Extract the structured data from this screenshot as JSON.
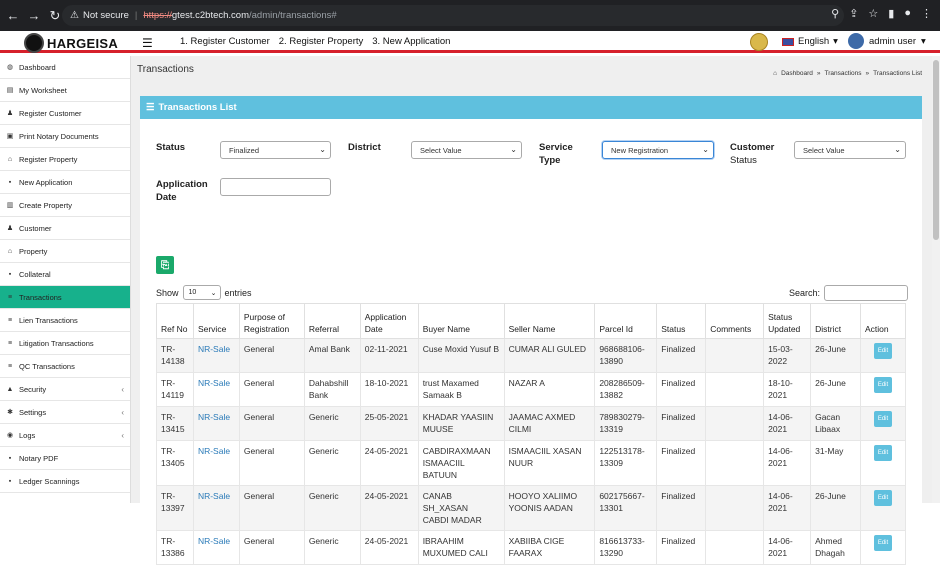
{
  "browser": {
    "not_secure": "Not secure",
    "url_scheme": "https://",
    "url_host": "gtest.c2btech.com",
    "url_path": "/admin/transactions#"
  },
  "header": {
    "logo_text": "HARGEISA",
    "nav": [
      "1. Register Customer",
      "2. Register Property",
      "3. New Application"
    ],
    "language": "English",
    "user": "admin user"
  },
  "sidebar": {
    "items": [
      {
        "label": "Dashboard",
        "icon": "dashboard-icon"
      },
      {
        "label": "My Worksheet",
        "icon": "worksheet-icon"
      },
      {
        "label": "Register Customer",
        "icon": "user-icon"
      },
      {
        "label": "Print Notary Documents",
        "icon": "print-icon"
      },
      {
        "label": "Register Property",
        "icon": "home-icon"
      },
      {
        "label": "New Application",
        "icon": "file-icon"
      },
      {
        "label": "Create Property",
        "icon": "building-icon"
      },
      {
        "label": "Customer",
        "icon": "user-icon"
      },
      {
        "label": "Property",
        "icon": "home-icon"
      },
      {
        "label": "Collateral",
        "icon": "file-icon"
      },
      {
        "label": "Transactions",
        "icon": "list-icon"
      },
      {
        "label": "Lien Transactions",
        "icon": "list-icon"
      },
      {
        "label": "Litigation Transactions",
        "icon": "list-icon"
      },
      {
        "label": "QC Transactions",
        "icon": "list-icon"
      },
      {
        "label": "Security",
        "icon": "lock-icon"
      },
      {
        "label": "Settings",
        "icon": "gear-icon"
      },
      {
        "label": "Logs",
        "icon": "eye-icon"
      },
      {
        "label": "Notary PDF",
        "icon": "file-icon"
      },
      {
        "label": "Ledger Scannings",
        "icon": "file-icon"
      }
    ]
  },
  "page": {
    "title": "Transactions",
    "breadcrumb": [
      "Dashboard",
      "Transactions",
      "Transactions List"
    ],
    "panel_title": "Transactions List"
  },
  "filters": {
    "status_label": "Status",
    "status_value": "Finalized",
    "district_label": "District",
    "district_value": "Select Value",
    "service_type_label_1": "Service",
    "service_type_label_2": "Type",
    "service_type_value": "New Registration",
    "customer_status_label_1": "Customer",
    "customer_status_label_2": "Status",
    "customer_status_value": "Select Value",
    "app_date_label_1": "Application",
    "app_date_label_2": "Date"
  },
  "table_controls": {
    "show_label": "Show",
    "show_value": "10",
    "entries_label": "entries",
    "search_label": "Search:"
  },
  "table": {
    "headers": [
      [
        "Ref No"
      ],
      [
        "Service"
      ],
      [
        "Purpose of",
        "Registration"
      ],
      [
        "Referral"
      ],
      [
        "Application",
        "Date"
      ],
      [
        "Buyer Name"
      ],
      [
        "Seller Name"
      ],
      [
        "Parcel Id"
      ],
      [
        "Status"
      ],
      [
        "Comments"
      ],
      [
        "Status",
        "Updated"
      ],
      [
        "District"
      ],
      [
        "Action"
      ]
    ],
    "rows": [
      {
        "ref": [
          "TR-",
          "14138"
        ],
        "service": "NR-Sale",
        "purpose": "General",
        "referral": [
          "Amal Bank"
        ],
        "app_date": "02-11-2021",
        "buyer": [
          "Cuse Moxid Yusuf B"
        ],
        "seller": [
          "CUMAR ALI GULED"
        ],
        "parcel": [
          "968688106-",
          "13890"
        ],
        "status": "Finalized",
        "comments": "",
        "updated": [
          "15-03-",
          "2022"
        ],
        "district": [
          "26-June"
        ],
        "action": "Edit"
      },
      {
        "ref": [
          "TR-",
          "14119"
        ],
        "service": "NR-Sale",
        "purpose": "General",
        "referral": [
          "Dahabshill",
          "Bank"
        ],
        "app_date": "18-10-2021",
        "buyer": [
          "trust Maxamed",
          "Samaak B"
        ],
        "seller": [
          "NAZAR A"
        ],
        "parcel": [
          "208286509-",
          "13882"
        ],
        "status": "Finalized",
        "comments": "",
        "updated": [
          "18-10-",
          "2021"
        ],
        "district": [
          "26-June"
        ],
        "action": "Edit"
      },
      {
        "ref": [
          "TR-",
          "13415"
        ],
        "service": "NR-Sale",
        "purpose": "General",
        "referral": [
          "Generic"
        ],
        "app_date": "25-05-2021",
        "buyer": [
          "KHADAR YAASIIN",
          "MUUSE"
        ],
        "seller": [
          "JAAMAC AXMED",
          "CILMI"
        ],
        "parcel": [
          "789830279-",
          "13319"
        ],
        "status": "Finalized",
        "comments": "",
        "updated": [
          "14-06-",
          "2021"
        ],
        "district": [
          "Gacan",
          "Libaax"
        ],
        "action": "Edit"
      },
      {
        "ref": [
          "TR-",
          "13405"
        ],
        "service": "NR-Sale",
        "purpose": "General",
        "referral": [
          "Generic"
        ],
        "app_date": "24-05-2021",
        "buyer": [
          "CABDIRAXMAAN",
          "ISMAACIIL BATUUN"
        ],
        "seller": [
          "ISMAACIIL XASAN",
          "NUUR"
        ],
        "parcel": [
          "122513178-",
          "13309"
        ],
        "status": "Finalized",
        "comments": "",
        "updated": [
          "14-06-",
          "2021"
        ],
        "district": [
          "31-May"
        ],
        "action": "Edit"
      },
      {
        "ref": [
          "TR-",
          "13397"
        ],
        "service": "NR-Sale",
        "purpose": "General",
        "referral": [
          "Generic"
        ],
        "app_date": "24-05-2021",
        "buyer": [
          "CANAB SH_XASAN",
          "CABDI MADAR"
        ],
        "seller": [
          "HOOYO XALIIMO",
          "YOONIS AADAN"
        ],
        "parcel": [
          "602175667-",
          "13301"
        ],
        "status": "Finalized",
        "comments": "",
        "updated": [
          "14-06-",
          "2021"
        ],
        "district": [
          "26-June"
        ],
        "action": "Edit"
      },
      {
        "ref": [
          "TR-",
          "13386"
        ],
        "service": "NR-Sale",
        "purpose": "General",
        "referral": [
          "Generic"
        ],
        "app_date": "24-05-2021",
        "buyer": [
          "IBRAAHIM",
          "MUXUMED CALI"
        ],
        "seller": [
          "XABIIBA CIGE",
          "FAARAX"
        ],
        "parcel": [
          "816613733-",
          "13290"
        ],
        "status": "Finalized",
        "comments": "",
        "updated": [
          "14-06-",
          "2021"
        ],
        "district": [
          "Ahmed",
          "Dhagah"
        ],
        "action": "Edit"
      }
    ]
  },
  "colors": {
    "active_sidebar": "#17b18c",
    "panel_header": "#5fc0de",
    "link": "#2a7ab8",
    "header_red": "#d6202b",
    "header_green": "#1a9a3c"
  }
}
